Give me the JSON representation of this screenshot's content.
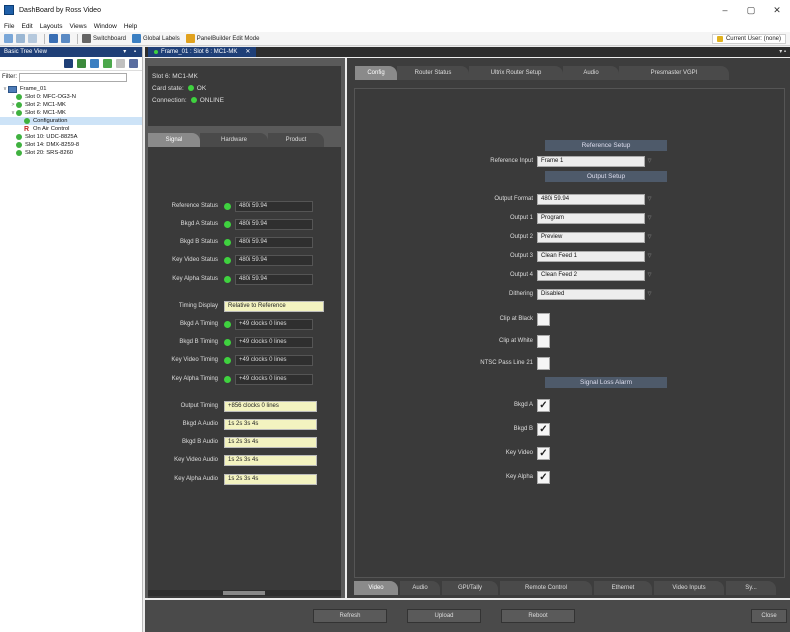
{
  "window": {
    "title": "DashBoard by Ross Video",
    "controls": [
      "–",
      "▢",
      "✕"
    ]
  },
  "menu": [
    "File",
    "Edit",
    "Layouts",
    "Views",
    "Window",
    "Help"
  ],
  "toolbar": {
    "switchboard": "Switchboard",
    "global_labels": "Global Labels",
    "panelbuilder": "PanelBuilder Edit Mode",
    "current_user": "Current User: (none)"
  },
  "tree": {
    "header": "Basic Tree View",
    "filter_label": "Filter:",
    "filter_value": "",
    "items": [
      {
        "label": "Frame_01",
        "kind": "frame",
        "indent": 0,
        "expander": "v"
      },
      {
        "label": "Slot 0: MFC-OG3-N",
        "kind": "dot",
        "indent": 1,
        "expander": ""
      },
      {
        "label": "Slot 2: MC1-MK",
        "kind": "dot",
        "indent": 1,
        "expander": ">"
      },
      {
        "label": "Slot 6: MC1-MK",
        "kind": "dot",
        "indent": 1,
        "expander": "v"
      },
      {
        "label": "Configuration",
        "kind": "dot",
        "indent": 2,
        "expander": "",
        "selected": true
      },
      {
        "label": "On Air Control",
        "kind": "flag",
        "indent": 2,
        "expander": ""
      },
      {
        "label": "Slot 10: UDC-8825A",
        "kind": "dot",
        "indent": 1,
        "expander": ""
      },
      {
        "label": "Slot 14: DMX-8259-8",
        "kind": "dot",
        "indent": 1,
        "expander": ""
      },
      {
        "label": "Slot 20: SRS-8260",
        "kind": "dot",
        "indent": 1,
        "expander": ""
      }
    ]
  },
  "doc_tab": {
    "label": "Frame_01 : Slot 6 : MC1-MK"
  },
  "card": {
    "slot": "Slot 6: MC1-MK",
    "card_state_label": "Card state:",
    "card_state_value": "OK",
    "connection_label": "Connection:",
    "connection_value": "ONLINE"
  },
  "card_tabs": [
    "Signal",
    "Hardware",
    "Product"
  ],
  "signal_rows": [
    {
      "label": "Reference Status",
      "value": "480i 59.94",
      "led": true,
      "style": "dark"
    },
    {
      "label": "Bkgd A Status",
      "value": "480i 59.94",
      "led": true,
      "style": "dark"
    },
    {
      "label": "Bkgd B Status",
      "value": "480i 59.94",
      "led": true,
      "style": "dark"
    },
    {
      "label": "Key Video Status",
      "value": "480i 59.94",
      "led": true,
      "style": "dark"
    },
    {
      "label": "Key Alpha Status",
      "value": "480i 59.94",
      "led": true,
      "style": "dark"
    },
    {
      "label": "Timing Display",
      "value": "Relative to Reference",
      "led": false,
      "style": "yellow"
    },
    {
      "label": "Bkgd A Timing",
      "value": "+49 clocks 0 lines",
      "led": true,
      "style": "dark"
    },
    {
      "label": "Bkgd B Timing",
      "value": "+49 clocks 0 lines",
      "led": true,
      "style": "dark"
    },
    {
      "label": "Key Video Timing",
      "value": "+49 clocks 0 lines",
      "led": true,
      "style": "dark"
    },
    {
      "label": "Key Alpha Timing",
      "value": "+49 clocks 0 lines",
      "led": true,
      "style": "dark"
    },
    {
      "label": "Output Timing",
      "value": "+856 clocks 0 lines",
      "led": false,
      "style": "yellow-short"
    },
    {
      "label": "Bkgd A Audio",
      "value": "1s 2s 3s 4s",
      "led": false,
      "style": "yellow-short"
    },
    {
      "label": "Bkgd B Audio",
      "value": "1s 2s 3s 4s",
      "led": false,
      "style": "yellow-short"
    },
    {
      "label": "Key Video Audio",
      "value": "1s 2s 3s 4s",
      "led": false,
      "style": "yellow-short"
    },
    {
      "label": "Key Alpha Audio",
      "value": "1s 2s 3s 4s",
      "led": false,
      "style": "yellow-short"
    }
  ],
  "config_tabs": [
    "Config",
    "Router Status",
    "Ultrix Router Setup",
    "Audio",
    "Presmaster VGPI"
  ],
  "reference_setup": {
    "header": "Reference Setup",
    "reference_input_label": "Reference Input",
    "reference_input_value": "Frame 1"
  },
  "output_setup": {
    "header": "Output Setup",
    "rows": [
      {
        "label": "Output Format",
        "value": "480i 59.94"
      },
      {
        "label": "Output 1",
        "value": "Program"
      },
      {
        "label": "Output 2",
        "value": "Preview"
      },
      {
        "label": "Output 3",
        "value": "Clean Feed 1"
      },
      {
        "label": "Output 4",
        "value": "Clean Feed 2"
      },
      {
        "label": "Dithering",
        "value": "Disabled"
      }
    ]
  },
  "checks": [
    {
      "label": "Clip at Black",
      "checked": false
    },
    {
      "label": "Clip at White",
      "checked": false
    },
    {
      "label": "NTSC Pass Line 21",
      "checked": false
    }
  ],
  "signal_loss_alarm": {
    "header": "Signal Loss Alarm",
    "rows": [
      {
        "label": "Bkgd A",
        "checked": true
      },
      {
        "label": "Bkgd B",
        "checked": true
      },
      {
        "label": "Key Video",
        "checked": true
      },
      {
        "label": "Key Alpha",
        "checked": true
      }
    ]
  },
  "bottom_tabs": [
    "Video",
    "Audio",
    "GPI/Tally",
    "Remote Control",
    "Ethernet",
    "Video Inputs",
    "Sy..."
  ],
  "buttons": {
    "refresh": "Refresh",
    "upload": "Upload",
    "reboot": "Reboot",
    "close": "Close"
  },
  "colors": {
    "led_green": "#3fd23f",
    "panel_dark": "#3a3a3a",
    "header_blue": "#1f3f77"
  }
}
